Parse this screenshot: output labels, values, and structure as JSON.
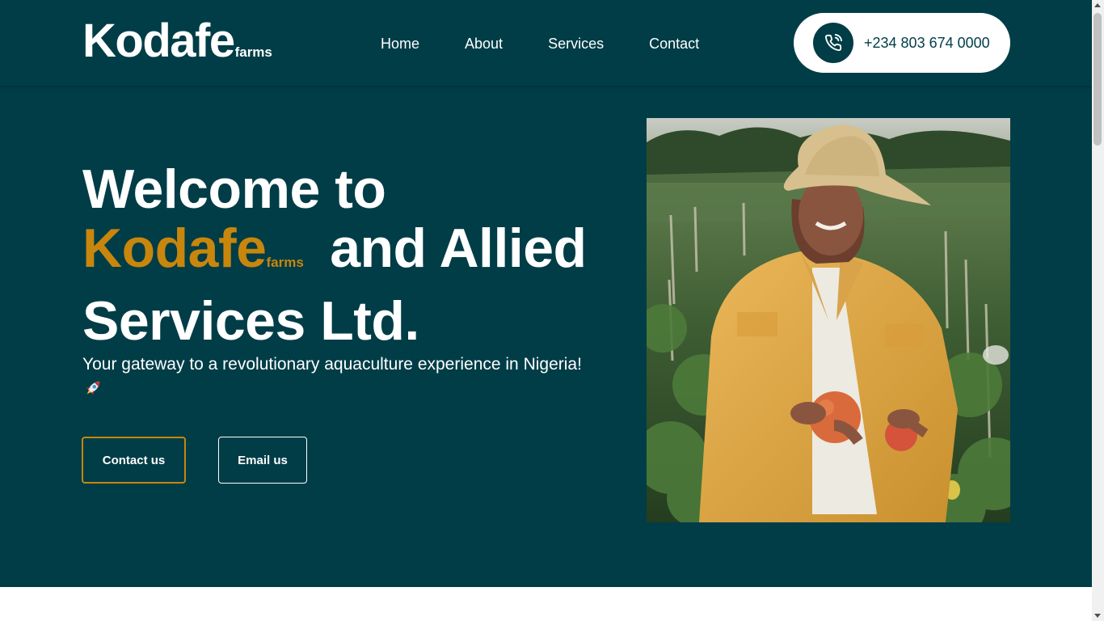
{
  "header": {
    "logo_main": "Kodafe",
    "logo_sub": "farms",
    "nav": [
      {
        "label": "Home"
      },
      {
        "label": "About"
      },
      {
        "label": "Services"
      },
      {
        "label": "Contact"
      }
    ],
    "phone_icon": "phone-icon",
    "phone_number": "+234 803 674 0000"
  },
  "hero": {
    "title_line1": "Welcome to",
    "title_brand": "Kodafe",
    "title_brand_sub": "farms",
    "title_rest": "and Allied Services Ltd.",
    "subtitle": "Your gateway to a revolutionary aquaculture experience in Nigeria!",
    "subtitle_icon": "rocket-icon",
    "contact_button": "Contact us",
    "email_button": "Email us",
    "image_icon": "farmer-photo"
  },
  "colors": {
    "primary": "#003d47",
    "accent": "#c8860d",
    "white": "#ffffff"
  }
}
